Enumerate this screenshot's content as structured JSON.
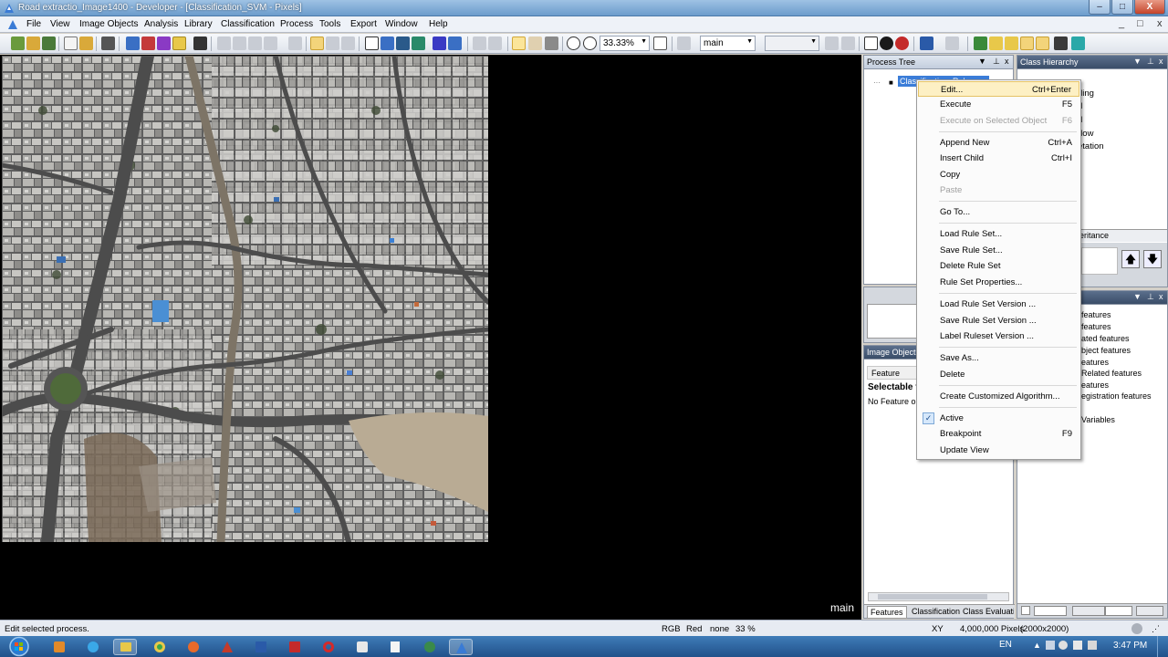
{
  "window": {
    "title": "Road extractio_Image1400 - Developer - [Classification_SVM - Pixels]",
    "min_label": "–",
    "max_label": "□",
    "close_label": "X"
  },
  "menubar": {
    "items": [
      "File",
      "View",
      "Image Objects",
      "Analysis",
      "Library",
      "Classification",
      "Process",
      "Tools",
      "Export",
      "Window",
      "Help"
    ],
    "mdi_min": "_",
    "mdi_restore": "□",
    "mdi_close": "x"
  },
  "toolbar": {
    "zoom_value": "33.33%",
    "layer_value": "main",
    "second_value": ""
  },
  "viewer": {
    "label": "main"
  },
  "process_tree": {
    "title": "Process Tree",
    "selected_item": "Classification_Rules",
    "pin": "▼",
    "close": "x"
  },
  "class_hierarchy": {
    "title": "Class Hierarchy",
    "visible_items": [
      "ding",
      "d",
      "d",
      "dow",
      "etation"
    ],
    "inheritance_tab": "eritance"
  },
  "feature_panel": {
    "title": "Image Object",
    "col_header": "Feature",
    "section": "Selectable f",
    "empty_text": "No Feature or",
    "tabs": [
      "Features",
      "Classification",
      "Class Evaluation"
    ]
  },
  "features_list": {
    "visible_items": [
      "features",
      "features",
      "ated features",
      "bject features",
      "eatures",
      "Related features",
      "eatures",
      "egistration features",
      "Variables"
    ]
  },
  "context_menu": {
    "items": [
      {
        "label": "Edit...",
        "shortcut": "Ctrl+Enter",
        "state": "highlighted"
      },
      {
        "label": "Execute",
        "shortcut": "F5",
        "state": "normal"
      },
      {
        "label": "Execute on Selected Object",
        "shortcut": "F6",
        "state": "disabled"
      },
      {
        "label": "Append New",
        "shortcut": "Ctrl+A",
        "state": "normal"
      },
      {
        "label": "Insert Child",
        "shortcut": "Ctrl+I",
        "state": "normal"
      },
      {
        "label": "Copy",
        "shortcut": "",
        "state": "normal"
      },
      {
        "label": "Paste",
        "shortcut": "",
        "state": "disabled"
      },
      {
        "label": "Go To...",
        "shortcut": "",
        "state": "normal"
      },
      {
        "label": "Load Rule Set...",
        "shortcut": "",
        "state": "normal"
      },
      {
        "label": "Save Rule Set...",
        "shortcut": "",
        "state": "normal"
      },
      {
        "label": "Delete Rule Set",
        "shortcut": "",
        "state": "normal"
      },
      {
        "label": "Rule Set Properties...",
        "shortcut": "",
        "state": "normal"
      },
      {
        "label": "Load Rule Set Version ...",
        "shortcut": "",
        "state": "normal"
      },
      {
        "label": "Save Rule Set Version ...",
        "shortcut": "",
        "state": "normal"
      },
      {
        "label": "Label Ruleset Version ...",
        "shortcut": "",
        "state": "normal"
      },
      {
        "label": "Save As...",
        "shortcut": "",
        "state": "normal"
      },
      {
        "label": "Delete",
        "shortcut": "",
        "state": "normal"
      },
      {
        "label": "Create Customized Algorithm...",
        "shortcut": "",
        "state": "normal"
      },
      {
        "label": "Active",
        "shortcut": "",
        "state": "checked"
      },
      {
        "label": "Breakpoint",
        "shortcut": "F9",
        "state": "normal"
      },
      {
        "label": "Update View",
        "shortcut": "",
        "state": "normal"
      }
    ]
  },
  "statusbar": {
    "message": "Edit selected process.",
    "mode": "RGB",
    "channel": "Red",
    "none": "none",
    "zoom": "33 %",
    "xy": "XY",
    "pixels": "4,000,000 Pixels",
    "size": "(2000x2000)"
  },
  "taskbar": {
    "language": "EN",
    "time": "3:47 PM"
  },
  "colors": {
    "titlebar": "#7aa5d2",
    "menu_highlight": "#fdf0c4",
    "selection": "#3b7dd8",
    "taskbar": "#2f66a2"
  }
}
